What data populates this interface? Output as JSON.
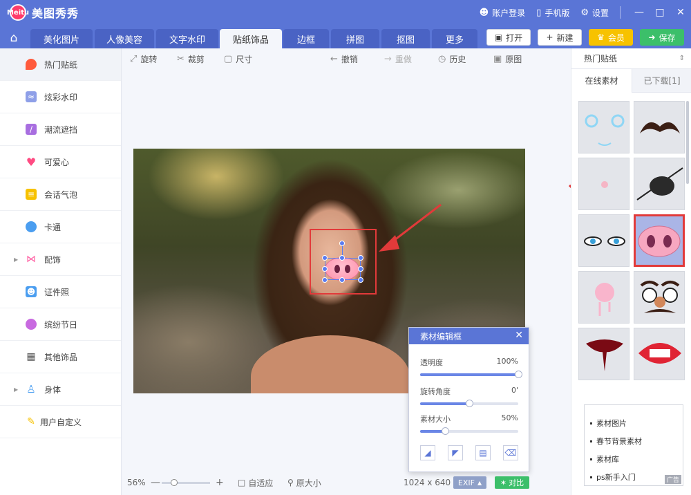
{
  "app": {
    "logo_text": "Meitu",
    "title": "美图秀秀"
  },
  "titlebar": {
    "login": "账户登录",
    "mobile": "手机版",
    "settings": "设置"
  },
  "tabs": [
    {
      "label": "美化图片"
    },
    {
      "label": "人像美容"
    },
    {
      "label": "文字水印"
    },
    {
      "label": "贴纸饰品"
    },
    {
      "label": "边框"
    },
    {
      "label": "拼图"
    },
    {
      "label": "抠图"
    },
    {
      "label": "更多"
    }
  ],
  "actions": {
    "open": "打开",
    "new": "新建",
    "vip": "会员",
    "save": "保存"
  },
  "sidebar": {
    "items": [
      {
        "label": "热门贴纸",
        "color": "#ff5a3c"
      },
      {
        "label": "炫彩水印",
        "color": "#8e9fe8"
      },
      {
        "label": "潮流遮挡",
        "color": "#a86ee0"
      },
      {
        "label": "可爱心",
        "color": "#ff4b82"
      },
      {
        "label": "会话气泡",
        "color": "#f7c200"
      },
      {
        "label": "卡通",
        "color": "#4b9ef0"
      },
      {
        "label": "配饰",
        "color": "#ff5aa0"
      },
      {
        "label": "证件照",
        "color": "#4b9ef0"
      },
      {
        "label": "缤纷节日",
        "color": "#c86ae0"
      },
      {
        "label": "其他饰品",
        "color": "#555555"
      },
      {
        "label": "身体",
        "color": "#4b9ef0"
      },
      {
        "label": "用户自定义",
        "color": "#f7c200"
      }
    ]
  },
  "toolbar": {
    "rotate": "旋转",
    "crop": "裁剪",
    "size": "尺寸",
    "undo": "撤销",
    "redo": "重做",
    "history": "历史",
    "original": "原图"
  },
  "edit_panel": {
    "title": "素材编辑框",
    "opacity_label": "透明度",
    "opacity_value": "100%",
    "opacity_level": 1.0,
    "rotation_label": "旋转角度",
    "rotation_value": "0'",
    "rotation_level": 0.5,
    "size_label": "素材大小",
    "size_value": "50%",
    "size_level": 0.25
  },
  "status": {
    "zoom": "56%",
    "zoom_level": 0.25,
    "fit": "自适应",
    "actual": "原大小",
    "image_size": "1024 x 640",
    "exif": "EXIF",
    "compare": "对比"
  },
  "right_panel": {
    "category": "热门贴纸",
    "tab_online": "在线素材",
    "tab_downloaded": "已下载[1]",
    "ad_items": [
      "素材图片",
      "春节背景素材",
      "素材库",
      "ps新手入门"
    ],
    "ad_tag": "广告"
  },
  "colors": {
    "primary": "#5a75d6",
    "highlight": "#e23a3a",
    "save": "#3cbf6a",
    "vip": "#f7c200"
  }
}
